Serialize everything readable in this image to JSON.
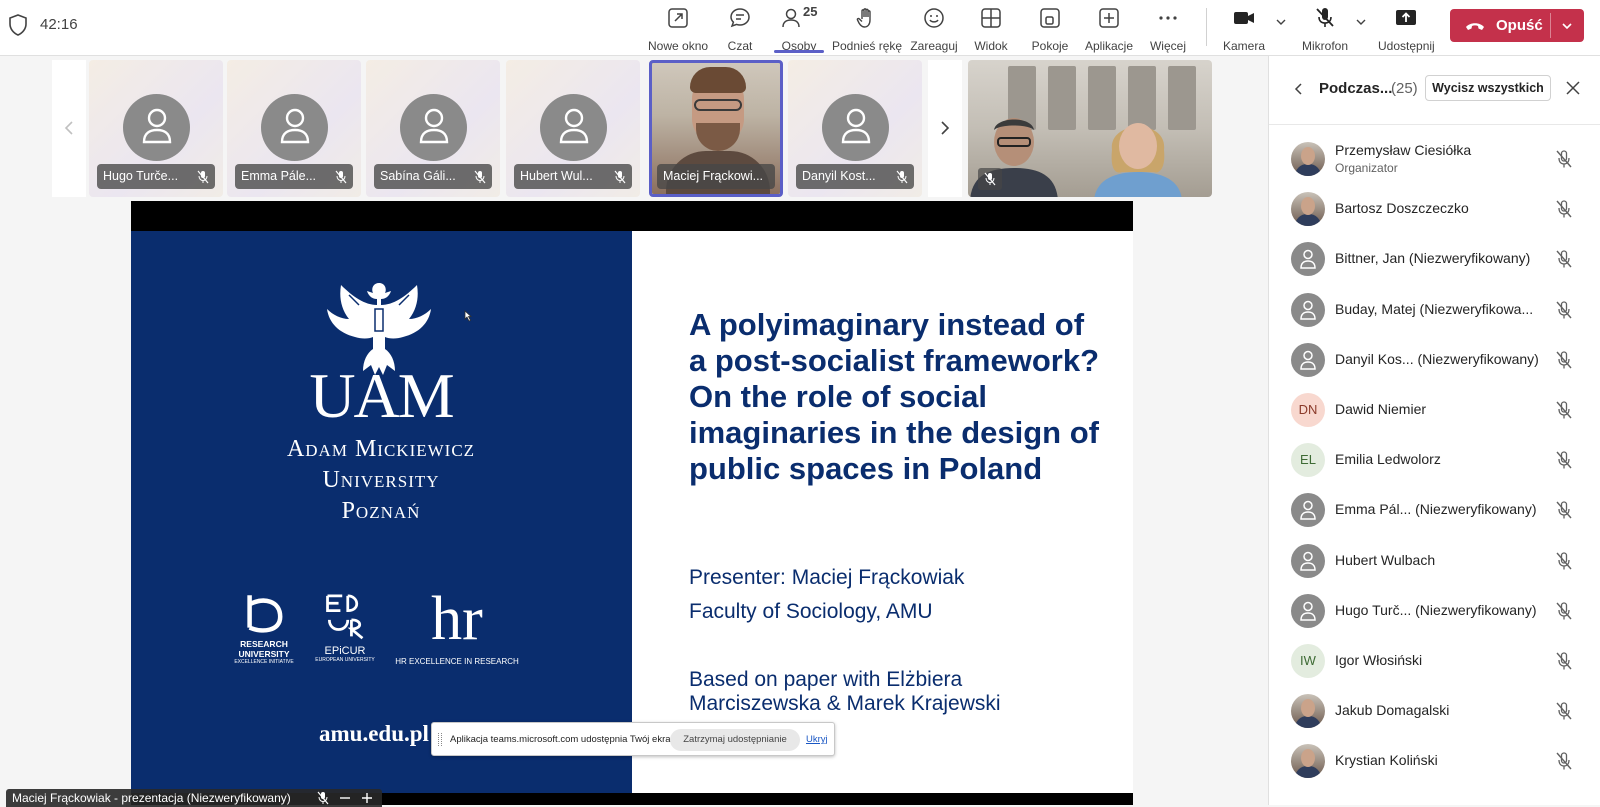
{
  "timer": "42:16",
  "toolbar": {
    "new_window": "Nowe okno",
    "chat": "Czat",
    "people": "Osoby",
    "people_count": "25",
    "raise_hand": "Podnieś rękę",
    "react": "Zareaguj",
    "view": "Widok",
    "rooms": "Pokoje",
    "apps": "Aplikacje",
    "more": "Więcej",
    "camera": "Kamera",
    "mic": "Mikrofon",
    "share": "Udostępnij",
    "leave": "Opuść"
  },
  "strip": {
    "tiles": [
      {
        "name": "Hugo Turče..."
      },
      {
        "name": "Emma Pále..."
      },
      {
        "name": "Sabína Gáli..."
      },
      {
        "name": "Hubert Wul..."
      },
      {
        "name": "Maciej Frąckowi..."
      },
      {
        "name": "Danyil Kost..."
      }
    ]
  },
  "slide": {
    "university_line1": "Adam Mickiewicz",
    "university_line2": "University",
    "university_line3": "Poznań",
    "uam": "UAM",
    "logo1_line1": "RESEARCH",
    "logo1_line2": "UNIVERSITY",
    "logo1_line3": "EXCELLENCE INITIATIVE",
    "logo2": "EPiCUR",
    "logo2_sub": "EUROPEAN UNIVERSITY",
    "logo3": "hr",
    "logo3_sub": "HR EXCELLENCE IN RESEARCH",
    "url": "amu.edu.pl",
    "title": "A polyimaginary instead of a post-socialist framework? On the role of social imaginaries in the design of public spaces in Poland",
    "presenter": "Presenter: Maciej Frąckowiak",
    "faculty": "Faculty of Sociology, AMU",
    "based1": "Based on paper with Elżbiera",
    "based2": "Marciszewska & Marek Krajewski"
  },
  "sharebar": {
    "message": "Aplikacja teams.microsoft.com udostępnia Twój ekran.",
    "stop": "Zatrzymaj udostępnianie",
    "hide": "Ukryj"
  },
  "caption": "Maciej Frąckowiak - prezentacja (Niezweryfikowany)",
  "panel": {
    "title": "Podczas...",
    "count": "(25)",
    "mute_all": "Wycisz wszystkich",
    "people": [
      {
        "name": "Przemysław Ciesiółka",
        "role": "Organizator",
        "avatar": "photo"
      },
      {
        "name": "Bartosz Doszczeczko",
        "avatar": "photo"
      },
      {
        "name": "Bittner, Jan (Niezweryfikowany)",
        "avatar": "gray"
      },
      {
        "name": "Buday, Matej (Niezweryfikowa...",
        "avatar": "gray"
      },
      {
        "name": "Danyil Kos... (Niezweryfikowany)",
        "avatar": "gray"
      },
      {
        "name": "Dawid Niemier",
        "avatar": "DN",
        "color": "#f8d8cf",
        "fg": "#8a3a2a"
      },
      {
        "name": "Emilia Ledwolorz",
        "avatar": "EL",
        "color": "#e3ecdf",
        "fg": "#3e6b35"
      },
      {
        "name": "Emma Pál... (Niezweryfikowany)",
        "avatar": "gray"
      },
      {
        "name": "Hubert Wulbach",
        "avatar": "gray"
      },
      {
        "name": "Hugo Turč... (Niezweryfikowany)",
        "avatar": "gray"
      },
      {
        "name": "Igor Włosiński",
        "avatar": "IW",
        "color": "#e3ecdf",
        "fg": "#3e6b35"
      },
      {
        "name": "Jakub Domagalski",
        "avatar": "photo"
      },
      {
        "name": "Krystian Koliński",
        "avatar": "photo"
      }
    ]
  }
}
